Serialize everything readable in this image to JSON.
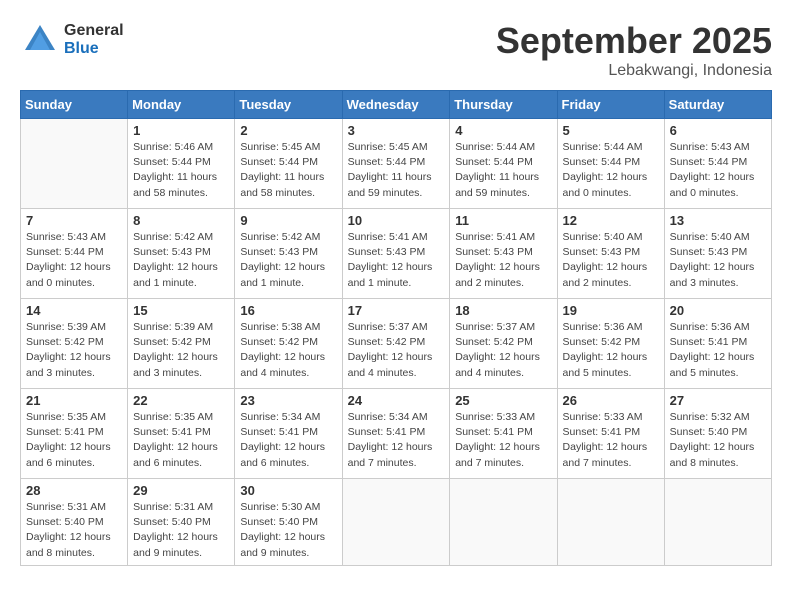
{
  "logo": {
    "general": "General",
    "blue": "Blue"
  },
  "title": "September 2025",
  "location": "Lebakwangi, Indonesia",
  "days_header": [
    "Sunday",
    "Monday",
    "Tuesday",
    "Wednesday",
    "Thursday",
    "Friday",
    "Saturday"
  ],
  "weeks": [
    [
      {
        "num": "",
        "info": ""
      },
      {
        "num": "1",
        "info": "Sunrise: 5:46 AM\nSunset: 5:44 PM\nDaylight: 11 hours\nand 58 minutes."
      },
      {
        "num": "2",
        "info": "Sunrise: 5:45 AM\nSunset: 5:44 PM\nDaylight: 11 hours\nand 58 minutes."
      },
      {
        "num": "3",
        "info": "Sunrise: 5:45 AM\nSunset: 5:44 PM\nDaylight: 11 hours\nand 59 minutes."
      },
      {
        "num": "4",
        "info": "Sunrise: 5:44 AM\nSunset: 5:44 PM\nDaylight: 11 hours\nand 59 minutes."
      },
      {
        "num": "5",
        "info": "Sunrise: 5:44 AM\nSunset: 5:44 PM\nDaylight: 12 hours\nand 0 minutes."
      },
      {
        "num": "6",
        "info": "Sunrise: 5:43 AM\nSunset: 5:44 PM\nDaylight: 12 hours\nand 0 minutes."
      }
    ],
    [
      {
        "num": "7",
        "info": "Sunrise: 5:43 AM\nSunset: 5:44 PM\nDaylight: 12 hours\nand 0 minutes."
      },
      {
        "num": "8",
        "info": "Sunrise: 5:42 AM\nSunset: 5:43 PM\nDaylight: 12 hours\nand 1 minute."
      },
      {
        "num": "9",
        "info": "Sunrise: 5:42 AM\nSunset: 5:43 PM\nDaylight: 12 hours\nand 1 minute."
      },
      {
        "num": "10",
        "info": "Sunrise: 5:41 AM\nSunset: 5:43 PM\nDaylight: 12 hours\nand 1 minute."
      },
      {
        "num": "11",
        "info": "Sunrise: 5:41 AM\nSunset: 5:43 PM\nDaylight: 12 hours\nand 2 minutes."
      },
      {
        "num": "12",
        "info": "Sunrise: 5:40 AM\nSunset: 5:43 PM\nDaylight: 12 hours\nand 2 minutes."
      },
      {
        "num": "13",
        "info": "Sunrise: 5:40 AM\nSunset: 5:43 PM\nDaylight: 12 hours\nand 3 minutes."
      }
    ],
    [
      {
        "num": "14",
        "info": "Sunrise: 5:39 AM\nSunset: 5:42 PM\nDaylight: 12 hours\nand 3 minutes."
      },
      {
        "num": "15",
        "info": "Sunrise: 5:39 AM\nSunset: 5:42 PM\nDaylight: 12 hours\nand 3 minutes."
      },
      {
        "num": "16",
        "info": "Sunrise: 5:38 AM\nSunset: 5:42 PM\nDaylight: 12 hours\nand 4 minutes."
      },
      {
        "num": "17",
        "info": "Sunrise: 5:37 AM\nSunset: 5:42 PM\nDaylight: 12 hours\nand 4 minutes."
      },
      {
        "num": "18",
        "info": "Sunrise: 5:37 AM\nSunset: 5:42 PM\nDaylight: 12 hours\nand 4 minutes."
      },
      {
        "num": "19",
        "info": "Sunrise: 5:36 AM\nSunset: 5:42 PM\nDaylight: 12 hours\nand 5 minutes."
      },
      {
        "num": "20",
        "info": "Sunrise: 5:36 AM\nSunset: 5:41 PM\nDaylight: 12 hours\nand 5 minutes."
      }
    ],
    [
      {
        "num": "21",
        "info": "Sunrise: 5:35 AM\nSunset: 5:41 PM\nDaylight: 12 hours\nand 6 minutes."
      },
      {
        "num": "22",
        "info": "Sunrise: 5:35 AM\nSunset: 5:41 PM\nDaylight: 12 hours\nand 6 minutes."
      },
      {
        "num": "23",
        "info": "Sunrise: 5:34 AM\nSunset: 5:41 PM\nDaylight: 12 hours\nand 6 minutes."
      },
      {
        "num": "24",
        "info": "Sunrise: 5:34 AM\nSunset: 5:41 PM\nDaylight: 12 hours\nand 7 minutes."
      },
      {
        "num": "25",
        "info": "Sunrise: 5:33 AM\nSunset: 5:41 PM\nDaylight: 12 hours\nand 7 minutes."
      },
      {
        "num": "26",
        "info": "Sunrise: 5:33 AM\nSunset: 5:41 PM\nDaylight: 12 hours\nand 7 minutes."
      },
      {
        "num": "27",
        "info": "Sunrise: 5:32 AM\nSunset: 5:40 PM\nDaylight: 12 hours\nand 8 minutes."
      }
    ],
    [
      {
        "num": "28",
        "info": "Sunrise: 5:31 AM\nSunset: 5:40 PM\nDaylight: 12 hours\nand 8 minutes."
      },
      {
        "num": "29",
        "info": "Sunrise: 5:31 AM\nSunset: 5:40 PM\nDaylight: 12 hours\nand 9 minutes."
      },
      {
        "num": "30",
        "info": "Sunrise: 5:30 AM\nSunset: 5:40 PM\nDaylight: 12 hours\nand 9 minutes."
      },
      {
        "num": "",
        "info": ""
      },
      {
        "num": "",
        "info": ""
      },
      {
        "num": "",
        "info": ""
      },
      {
        "num": "",
        "info": ""
      }
    ]
  ]
}
